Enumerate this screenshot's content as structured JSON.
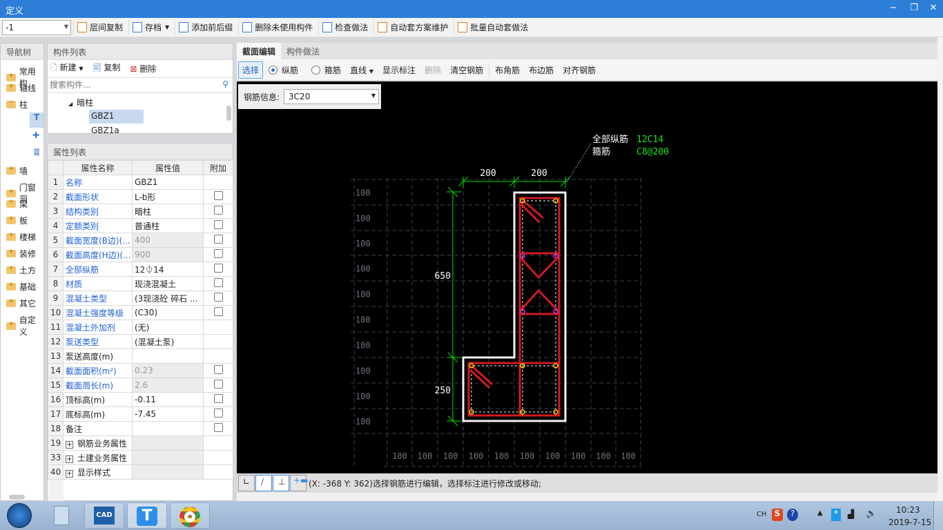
{
  "window": {
    "title": "定义",
    "min": "−",
    "restore": "❐",
    "close": "✕"
  },
  "toolbar": {
    "floor": "-1",
    "items": [
      "层间复制",
      "存档",
      "添加前后缀",
      "删除未使用构件",
      "检查做法",
      "自动套方案维护",
      "批量自动套做法"
    ]
  },
  "nav": {
    "title": "导航树",
    "items": [
      "常用构",
      "轴线",
      "柱",
      "墙",
      "门窗洞",
      "梁",
      "板",
      "楼梯",
      "装修",
      "土方",
      "基础",
      "其它",
      "自定义"
    ]
  },
  "complist": {
    "title": "构件列表",
    "new": "新建",
    "copy": "复制",
    "delete": "删除",
    "search_placeholder": "搜索构件...",
    "group": "暗柱",
    "items": [
      "GBZ1",
      "GBZ1a"
    ]
  },
  "props": {
    "title": "属性列表",
    "headers": [
      "属性名称",
      "属性值",
      "附加"
    ],
    "rows": [
      {
        "n": "1",
        "name": "名称",
        "value": "GBZ1"
      },
      {
        "n": "2",
        "name": "截面形状",
        "value": "L-b形"
      },
      {
        "n": "3",
        "name": "结构类别",
        "value": "暗柱"
      },
      {
        "n": "4",
        "name": "定额类别",
        "value": "普通柱"
      },
      {
        "n": "5",
        "name": "截面宽度(B边)(...",
        "value": "400"
      },
      {
        "n": "6",
        "name": "截面高度(H边)(...",
        "value": "900"
      },
      {
        "n": "7",
        "name": "全部纵筋",
        "value": "12⏀14"
      },
      {
        "n": "8",
        "name": "材质",
        "value": "现浇混凝土"
      },
      {
        "n": "9",
        "name": "混凝土类型",
        "value": "(3现浇砼 碎石 ..."
      },
      {
        "n": "10",
        "name": "混凝土强度等级",
        "value": "(C30)"
      },
      {
        "n": "11",
        "name": "混凝土外加剂",
        "value": "(无)"
      },
      {
        "n": "12",
        "name": "泵送类型",
        "value": "(混凝土泵)"
      },
      {
        "n": "13",
        "name": "泵送高度(m)",
        "value": ""
      },
      {
        "n": "14",
        "name": "截面面积(m²)",
        "value": "0.23"
      },
      {
        "n": "15",
        "name": "截面周长(m)",
        "value": "2.6"
      },
      {
        "n": "16",
        "name": "顶标高(m)",
        "value": "-0.11"
      },
      {
        "n": "17",
        "name": "底标高(m)",
        "value": "-7.45"
      },
      {
        "n": "18",
        "name": "备注",
        "value": ""
      },
      {
        "n": "19",
        "name": "钢筋业务属性",
        "value": ""
      },
      {
        "n": "33",
        "name": "土建业务属性",
        "value": ""
      },
      {
        "n": "40",
        "name": "显示样式",
        "value": ""
      }
    ]
  },
  "editor": {
    "tabs": [
      "截面编辑",
      "构件做法"
    ],
    "tools": {
      "select": "选择",
      "long": "纵筋",
      "stirrup": "箍筋",
      "line": "直线",
      "show_dim": "显示标注",
      "delete": "删除",
      "clear": "清空钢筋",
      "corner": "布角筋",
      "edge": "布边筋",
      "align": "对齐钢筋"
    },
    "rebar_info_label": "钢筋信息:",
    "rebar_info_value": "3C20",
    "annot": {
      "l1": "全部纵筋",
      "v1": "12C14",
      "l2": "箍筋",
      "v2": "C8@200"
    },
    "dims": {
      "w1": "200",
      "w2": "200",
      "h1": "650",
      "h2": "250",
      "grid": "100"
    },
    "status": "(X: -368 Y: 362)选择钢筋进行编辑，选择标注进行修改或移动;"
  },
  "taskbar": {
    "lang": "CH",
    "time": "10:23",
    "date": "2019-7-15"
  }
}
